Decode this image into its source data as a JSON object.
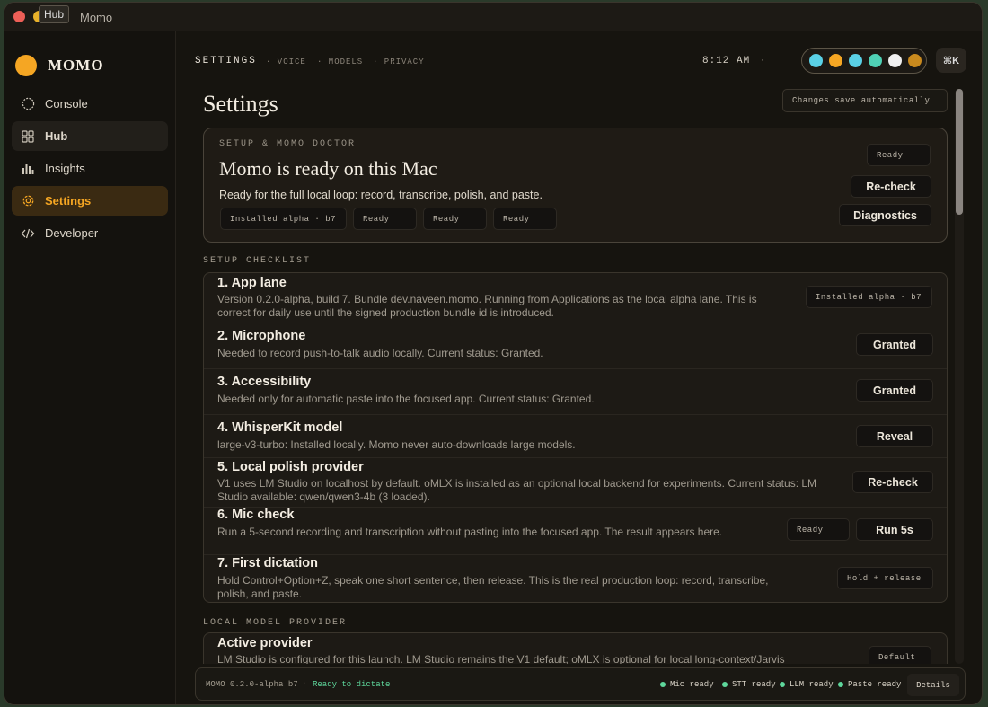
{
  "window": {
    "title": "Momo",
    "tooltip": "Hub"
  },
  "brand": {
    "name": "MOMO",
    "color": "#f5a623"
  },
  "sidebar": {
    "items": [
      {
        "label": "Console",
        "icon": "circle-dashed-icon"
      },
      {
        "label": "Hub",
        "icon": "grid-icon"
      },
      {
        "label": "Insights",
        "icon": "bar-chart-icon"
      },
      {
        "label": "Settings",
        "icon": "gear-icon",
        "active": true
      },
      {
        "label": "Developer",
        "icon": "code-icon"
      }
    ]
  },
  "topbar": {
    "crumb": "SETTINGS",
    "sub": [
      "· VOICE",
      "· MODELS",
      "· PRIVACY"
    ],
    "clock": "8:12 AM",
    "clock_sep": "·",
    "swatches": [
      "#5ad1e6",
      "#f5a623",
      "#5ad1e6",
      "#4fd1b5",
      "#f0f0f0",
      "#c98a1e"
    ],
    "shortcut": "⌘K"
  },
  "page": {
    "title": "Settings",
    "autosave": "Changes save automatically"
  },
  "doctor": {
    "eyebrow": "SETUP & MOMO DOCTOR",
    "title": "Momo is ready on this Mac",
    "desc": "Ready for the full local loop: record, transcribe, polish, and paste.",
    "chips": [
      "Installed alpha · b7",
      "Ready",
      "Ready",
      "Ready"
    ],
    "status": "Ready",
    "recheck": "Re-check",
    "diagnostics": "Diagnostics"
  },
  "checklist": {
    "label": "SETUP CHECKLIST",
    "rows": [
      {
        "title": "1. App lane",
        "desc": "Version 0.2.0-alpha, build 7. Bundle dev.naveen.momo. Running from Applications as the local alpha lane. This is correct for daily use until the signed production bundle id is introduced.",
        "action": "Installed alpha · b7"
      },
      {
        "title": "2. Microphone",
        "desc": "Needed to record push-to-talk audio locally. Current status: Granted.",
        "action": "Granted"
      },
      {
        "title": "3. Accessibility",
        "desc": "Needed only for automatic paste into the focused app. Current status: Granted.",
        "action": "Granted"
      },
      {
        "title": "4. WhisperKit model",
        "desc": "large-v3-turbo: Installed locally. Momo never auto-downloads large models.",
        "action": "Reveal"
      },
      {
        "title": "5. Local polish provider",
        "desc": "V1 uses LM Studio on localhost by default. oMLX is installed as an optional local backend for experiments. Current status: LM Studio available: qwen/qwen3-4b (3 loaded).",
        "action": "Re-check"
      },
      {
        "title": "6. Mic check",
        "desc": "Run a 5-second recording and transcription without pasting into the focused app. The result appears here.",
        "status": "Ready",
        "action": "Run 5s"
      },
      {
        "title": "7. First dictation",
        "desc": "Hold Control+Option+Z, speak one short sentence, then release. This is the real production loop: record, transcribe, polish, and paste.",
        "action": "Hold + release"
      }
    ]
  },
  "provider": {
    "label": "LOCAL MODEL PROVIDER",
    "title": "Active provider",
    "desc": "LM Studio is configured for this launch. LM Studio remains the V1 default; oMLX is optional for local long-context/Jarvis",
    "action": "Default"
  },
  "statusbar": {
    "version": "MOMO 0.2.0-alpha b7",
    "sep": "·",
    "ready": "Ready to dictate",
    "stats": [
      "Mic ready",
      "STT ready",
      "LLM ready",
      "Paste ready"
    ],
    "details": "Details"
  }
}
